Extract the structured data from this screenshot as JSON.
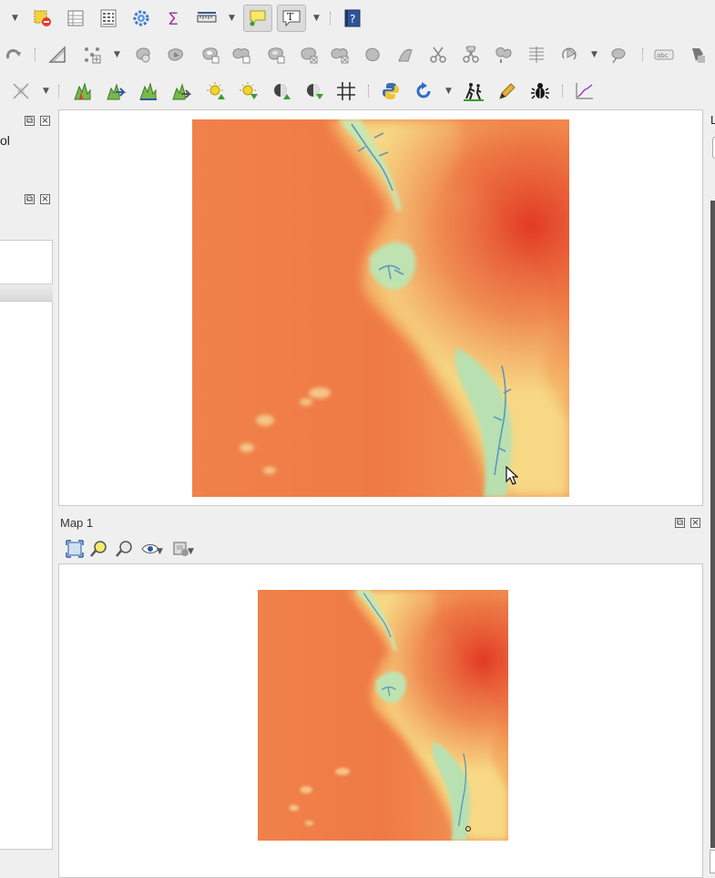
{
  "left_panel": {
    "partial_title": "ol"
  },
  "map_dock": {
    "title": "Map 1"
  },
  "right_panel": {
    "partial_label": "L"
  },
  "icons": {
    "row1": [
      "select-features-icon",
      "attribute-table-icon",
      "field-calculator-icon",
      "settings-gear-icon",
      "sum-icon",
      "measure-icon",
      "annotation-balloon-icon",
      "text-annotation-icon",
      "help-icon"
    ],
    "row2": [
      "redo-icon",
      "scale-tool-icon",
      "vertex-tool-icon",
      "advanced-digitizing-icons"
    ],
    "row3": [
      "snapping-icon",
      "profile-tool-icons",
      "light-tool-icons",
      "grid-icon",
      "python-icon",
      "refresh-icon",
      "hiking-icon",
      "pen-icon",
      "bug-icon",
      "chart-icon"
    ],
    "map_dock_toolbar": [
      "zoom-full-icon",
      "zoom-to-layer-icon",
      "zoom-to-selection-icon",
      "view-settings-icon",
      "style-settings-icon"
    ]
  },
  "colors": {
    "dem_low": "#4a8bc4",
    "dem_mid": "#e9f3b8",
    "dem_high": "#e23a24",
    "dem_base": "#f07b45"
  }
}
